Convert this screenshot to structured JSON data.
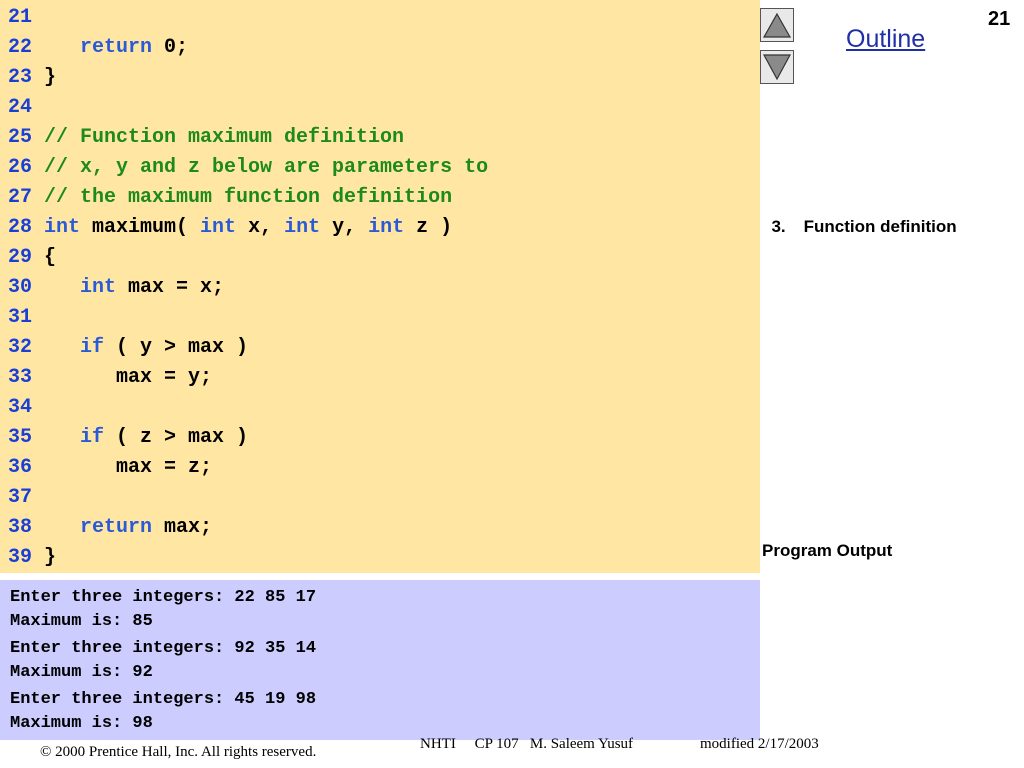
{
  "slide": {
    "page_number": "21",
    "outline_label": "Outline",
    "side_labels": {
      "function_definition_num": "3.",
      "function_definition_text": "Function definition",
      "program_output": "Program Output"
    }
  },
  "code": {
    "lines": [
      {
        "num": "21",
        "parts": []
      },
      {
        "num": "22",
        "parts": [
          {
            "t": "   ",
            "c": "pl"
          },
          {
            "t": "return",
            "c": "kw"
          },
          {
            "t": " 0;",
            "c": "pl"
          }
        ]
      },
      {
        "num": "23",
        "parts": [
          {
            "t": "}",
            "c": "pl"
          }
        ]
      },
      {
        "num": "24",
        "parts": []
      },
      {
        "num": "25",
        "parts": [
          {
            "t": "// Function maximum definition",
            "c": "cm"
          }
        ]
      },
      {
        "num": "26",
        "parts": [
          {
            "t": "// x, y and z below are parameters to",
            "c": "cm"
          }
        ]
      },
      {
        "num": "27",
        "parts": [
          {
            "t": "// the maximum function definition",
            "c": "cm"
          }
        ]
      },
      {
        "num": "28",
        "parts": [
          {
            "t": "int",
            "c": "kw"
          },
          {
            "t": " maximum( ",
            "c": "pl"
          },
          {
            "t": "int",
            "c": "kw"
          },
          {
            "t": " x, ",
            "c": "pl"
          },
          {
            "t": "int",
            "c": "kw"
          },
          {
            "t": " y, ",
            "c": "pl"
          },
          {
            "t": "int",
            "c": "kw"
          },
          {
            "t": " z )",
            "c": "pl"
          }
        ]
      },
      {
        "num": "29",
        "parts": [
          {
            "t": "{",
            "c": "pl"
          }
        ]
      },
      {
        "num": "30",
        "parts": [
          {
            "t": "   ",
            "c": "pl"
          },
          {
            "t": "int",
            "c": "kw"
          },
          {
            "t": " max = x;",
            "c": "pl"
          }
        ]
      },
      {
        "num": "31",
        "parts": []
      },
      {
        "num": "32",
        "parts": [
          {
            "t": "   ",
            "c": "pl"
          },
          {
            "t": "if",
            "c": "kw"
          },
          {
            "t": " ( y > max )",
            "c": "pl"
          }
        ]
      },
      {
        "num": "33",
        "parts": [
          {
            "t": "      max = y;",
            "c": "pl"
          }
        ]
      },
      {
        "num": "34",
        "parts": []
      },
      {
        "num": "35",
        "parts": [
          {
            "t": "   ",
            "c": "pl"
          },
          {
            "t": "if",
            "c": "kw"
          },
          {
            "t": " ( z > max )",
            "c": "pl"
          }
        ]
      },
      {
        "num": "36",
        "parts": [
          {
            "t": "      max = z;",
            "c": "pl"
          }
        ]
      },
      {
        "num": "37",
        "parts": []
      },
      {
        "num": "38",
        "parts": [
          {
            "t": "   ",
            "c": "pl"
          },
          {
            "t": "return",
            "c": "kw"
          },
          {
            "t": " max;",
            "c": "pl"
          }
        ]
      },
      {
        "num": "39",
        "parts": [
          {
            "t": "}",
            "c": "pl"
          }
        ]
      }
    ]
  },
  "output": {
    "lines": [
      "Enter three integers: 22 85 17",
      "Maximum is: 85",
      "Enter three integers: 92 35 14",
      "Maximum is: 92",
      "Enter three integers: 45 19 98",
      "Maximum is: 98"
    ]
  },
  "footer": {
    "copyright": "© 2000 Prentice Hall, Inc.  All rights reserved.",
    "course": "NHTI     CP 107   M. Saleem Yusuf",
    "modified": "modified 2/17/2003"
  },
  "icons": {
    "prev": "triangle-up-icon",
    "next": "triangle-down-icon"
  }
}
